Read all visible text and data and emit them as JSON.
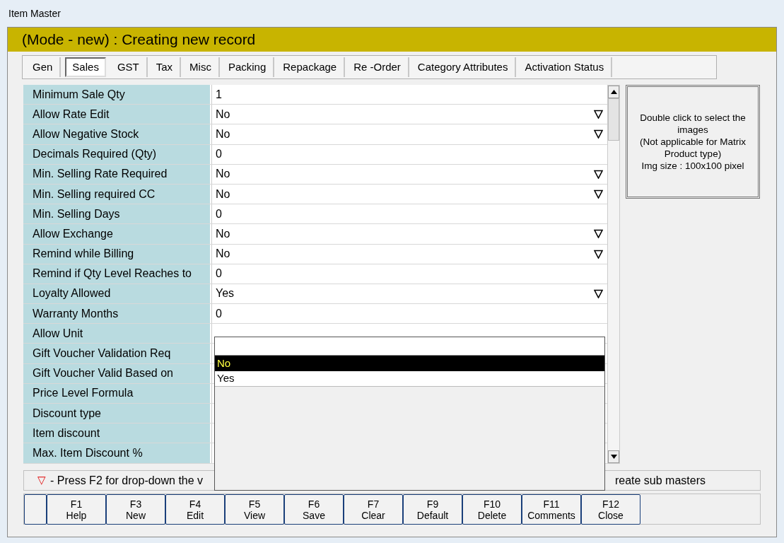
{
  "window": {
    "title": "Item Master"
  },
  "mode_banner": "(Mode - new) : Creating new record",
  "tabs": [
    {
      "label": "Gen",
      "selected": false
    },
    {
      "label": "Sales",
      "selected": true
    },
    {
      "label": "GST",
      "selected": false
    },
    {
      "label": "Tax",
      "selected": false
    },
    {
      "label": "Misc",
      "selected": false
    },
    {
      "label": "Packing",
      "selected": false
    },
    {
      "label": "Repackage",
      "selected": false
    },
    {
      "label": "Re -Order",
      "selected": false
    },
    {
      "label": "Category Attributes",
      "selected": false
    },
    {
      "label": "Activation Status",
      "selected": false
    }
  ],
  "fields": [
    {
      "label": "Minimum Sale Qty",
      "value": "1",
      "kind": "text"
    },
    {
      "label": "Allow Rate Edit",
      "value": "No",
      "kind": "dropdown"
    },
    {
      "label": "Allow Negative Stock",
      "value": "No",
      "kind": "dropdown"
    },
    {
      "label": "Decimals Required (Qty)",
      "value": "0",
      "kind": "text"
    },
    {
      "label": "Min. Selling Rate Required",
      "value": "No",
      "kind": "dropdown"
    },
    {
      "label": "Min. Selling required CC",
      "value": "No",
      "kind": "dropdown"
    },
    {
      "label": "Min. Selling Days",
      "value": "0",
      "kind": "text"
    },
    {
      "label": "Allow Exchange",
      "value": "No",
      "kind": "dropdown"
    },
    {
      "label": "Remind while Billing",
      "value": "No",
      "kind": "dropdown"
    },
    {
      "label": "Remind if Qty Level Reaches to",
      "value": "0",
      "kind": "text"
    },
    {
      "label": "Loyalty Allowed",
      "value": "Yes",
      "kind": "dropdown"
    },
    {
      "label": "Warranty Months",
      "value": "0",
      "kind": "text"
    },
    {
      "label": "Allow Unit",
      "kind": "text"
    },
    {
      "label": "Gift Voucher Validation Req",
      "kind": "text"
    },
    {
      "label": "Gift Voucher Valid Based on",
      "kind": "text"
    },
    {
      "label": "Price Level Formula",
      "kind": "text"
    },
    {
      "label": "Discount type",
      "kind": "text"
    },
    {
      "label": "Item discount",
      "kind": "text"
    },
    {
      "label": "Max. Item Discount %",
      "kind": "text"
    }
  ],
  "dropdown_list": {
    "options": [
      {
        "label": "No",
        "selected": true
      },
      {
        "label": "Yes",
        "selected": false
      }
    ]
  },
  "image_box": {
    "lines": [
      "Double click to select the images",
      "(Not applicable for Matrix Product type)",
      "Img size : 100x100 pixel"
    ]
  },
  "hint": {
    "marker": "▽",
    "parts": [
      "- Press F2 for drop-down the v",
      "reate sub masters"
    ]
  },
  "function_keys": [
    {
      "key": "F1",
      "label": "Help"
    },
    {
      "key": "F3",
      "label": "New"
    },
    {
      "key": "F4",
      "label": "Edit"
    },
    {
      "key": "F5",
      "label": "View"
    },
    {
      "key": "F6",
      "label": "Save"
    },
    {
      "key": "F7",
      "label": "Clear"
    },
    {
      "key": "F9",
      "label": "Default"
    },
    {
      "key": "F10",
      "label": "Delete"
    },
    {
      "key": "F11",
      "label": "Comments"
    },
    {
      "key": "F12",
      "label": "Close"
    }
  ]
}
